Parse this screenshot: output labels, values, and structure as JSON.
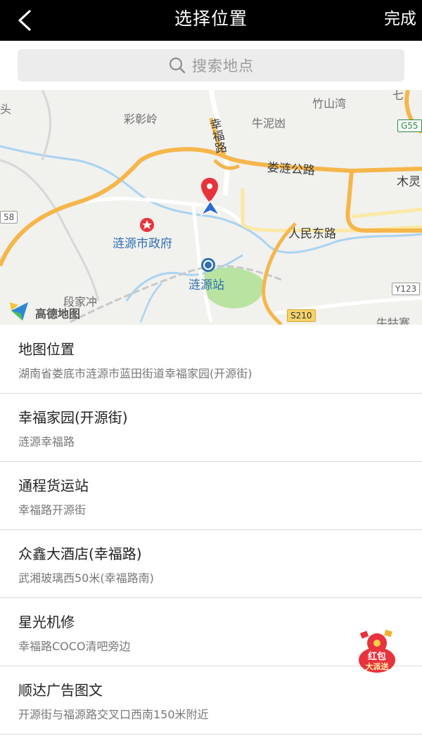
{
  "header": {
    "title": "选择位置",
    "done_label": "完成",
    "back_icon": "chevron-left-icon"
  },
  "search": {
    "placeholder": "搜索地点",
    "icon": "search-icon"
  },
  "map": {
    "labels": {
      "caizhangling": "彩彰岭",
      "zhushanwan": "竹山湾",
      "niunidang": "牛泥凼",
      "xingfu_road": "幸福路",
      "loulian_road": "娄涟公路",
      "mulin": "木灵",
      "renmin_east": "人民东路",
      "gov": "涟源市政府",
      "station": "涟源站",
      "duanjiachong": "段家冲",
      "niuzhuangzhai": "牛牯寨",
      "tou": "头",
      "qi": "七"
    },
    "road_numbers": {
      "g55": "G55",
      "s210": "S210",
      "y123": "Y123",
      "n58": "58"
    },
    "logo_text": "高德地图",
    "colors": {
      "highway": "#f5b64a",
      "water": "#a9d3f0",
      "park": "#b9e3a0",
      "pin": "#e8323c",
      "nav_arrow": "#2a6cd6"
    }
  },
  "locations": [
    {
      "name": "地图位置",
      "address": "湖南省娄底市涟源市蓝田街道幸福家园(开源街)"
    },
    {
      "name": "幸福家园(开源街)",
      "address": "涟源幸福路"
    },
    {
      "name": "通程货运站",
      "address": "幸福路开源街"
    },
    {
      "name": "众鑫大酒店(幸福路)",
      "address": "武湘玻璃西50米(幸福路南)"
    },
    {
      "name": "星光机修",
      "address": "幸福路COCO清吧旁边"
    },
    {
      "name": "顺达广告图文",
      "address": "开源街与福源路交叉口西南150米附近"
    }
  ],
  "promo": {
    "line1": "红包",
    "line2": "大派送"
  }
}
